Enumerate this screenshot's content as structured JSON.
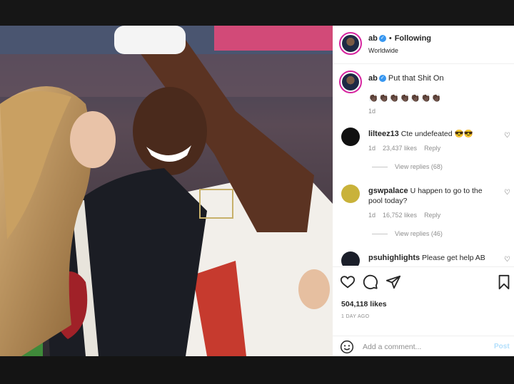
{
  "post": {
    "username": "ab",
    "follow_status": "Following",
    "location": "Worldwide",
    "caption": "Put that Shit On",
    "caption_emoji": "👏🏿👏🏿👏🏿👏🏿👏🏿👏🏿👏🏿",
    "caption_age": "1d",
    "likes": "504,118 likes",
    "date": "1 DAY AGO"
  },
  "comments": [
    {
      "username": "lilteez13",
      "text": "Cte undefeated 😎😎",
      "age": "1d",
      "likes": "23,437 likes",
      "reply_label": "Reply",
      "view_replies": "View replies (68)",
      "avatar_color": "#111111"
    },
    {
      "username": "gswpalace",
      "text": "U happen to go to the pool today?",
      "age": "1d",
      "likes": "16,752 likes",
      "reply_label": "Reply",
      "view_replies": "View replies (46)",
      "avatar_color": "#c9b23a"
    },
    {
      "username": "psuhighlights",
      "text": "Please get help AB",
      "avatar_color": "#1b1f2a"
    }
  ],
  "add_comment": {
    "placeholder": "Add a comment...",
    "post_label": "Post"
  },
  "icons": [
    "verified-badge",
    "heart-icon",
    "comment-icon",
    "share-icon",
    "bookmark-icon",
    "emoji-icon"
  ],
  "colors": {
    "accent_blue": "#3897f0",
    "post_disabled": "#b2dffc",
    "muted_text": "#8e8e8e"
  }
}
